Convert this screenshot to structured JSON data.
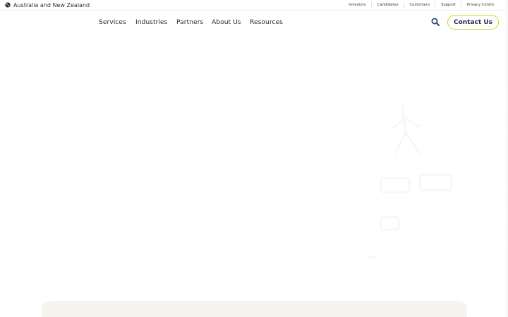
{
  "region": {
    "label": "Australia and New Zealand",
    "icon": "globe-icon"
  },
  "utility_links": [
    "Investors",
    "Candidates",
    "Customers",
    "Support",
    "Privacy Centre"
  ],
  "nav": {
    "items": [
      "Services",
      "Industries",
      "Partners",
      "About Us",
      "Resources"
    ],
    "search_icon": "search-icon",
    "contact_label": "Contact Us"
  },
  "colors": {
    "accent": "#c7d92c",
    "contact_text": "#1f2a44",
    "search_icon": "#2a4a6b",
    "panel_bg": "#f7f4ef"
  }
}
